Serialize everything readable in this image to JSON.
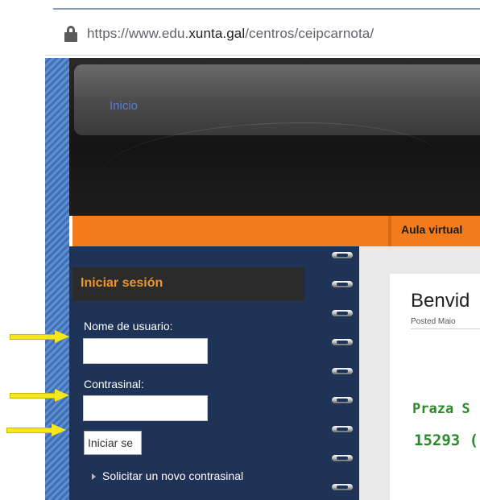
{
  "browser": {
    "url_prefix": "https://www.edu.",
    "url_domain": "xunta.gal",
    "url_path": "/centros/ceipcarnota/"
  },
  "header": {
    "nav_inicio": "Inicio",
    "aula_virtual": "Aula virtual"
  },
  "login": {
    "title": "Iniciar sesión",
    "username_label": "Nome de usuario:",
    "username_value": "",
    "password_label": "Contrasinal:",
    "password_value": "",
    "submit_label": "Iniciar se",
    "forgot_link": "Solicitar un novo contrasinal"
  },
  "post": {
    "title": "Benvid",
    "meta": "Posted Maio",
    "line1": "Praza S",
    "line2": "15293 ("
  },
  "colors": {
    "accent_orange": "#f37b1b",
    "sidebar_navy": "#1f3357",
    "title_orange": "#f0952b",
    "content_green": "#2a8a2a",
    "arrow_yellow": "#f4e81a"
  },
  "icons": [
    "lock-icon",
    "spiral-ring-icon",
    "triangle-bullet-icon",
    "arrow-icon"
  ]
}
